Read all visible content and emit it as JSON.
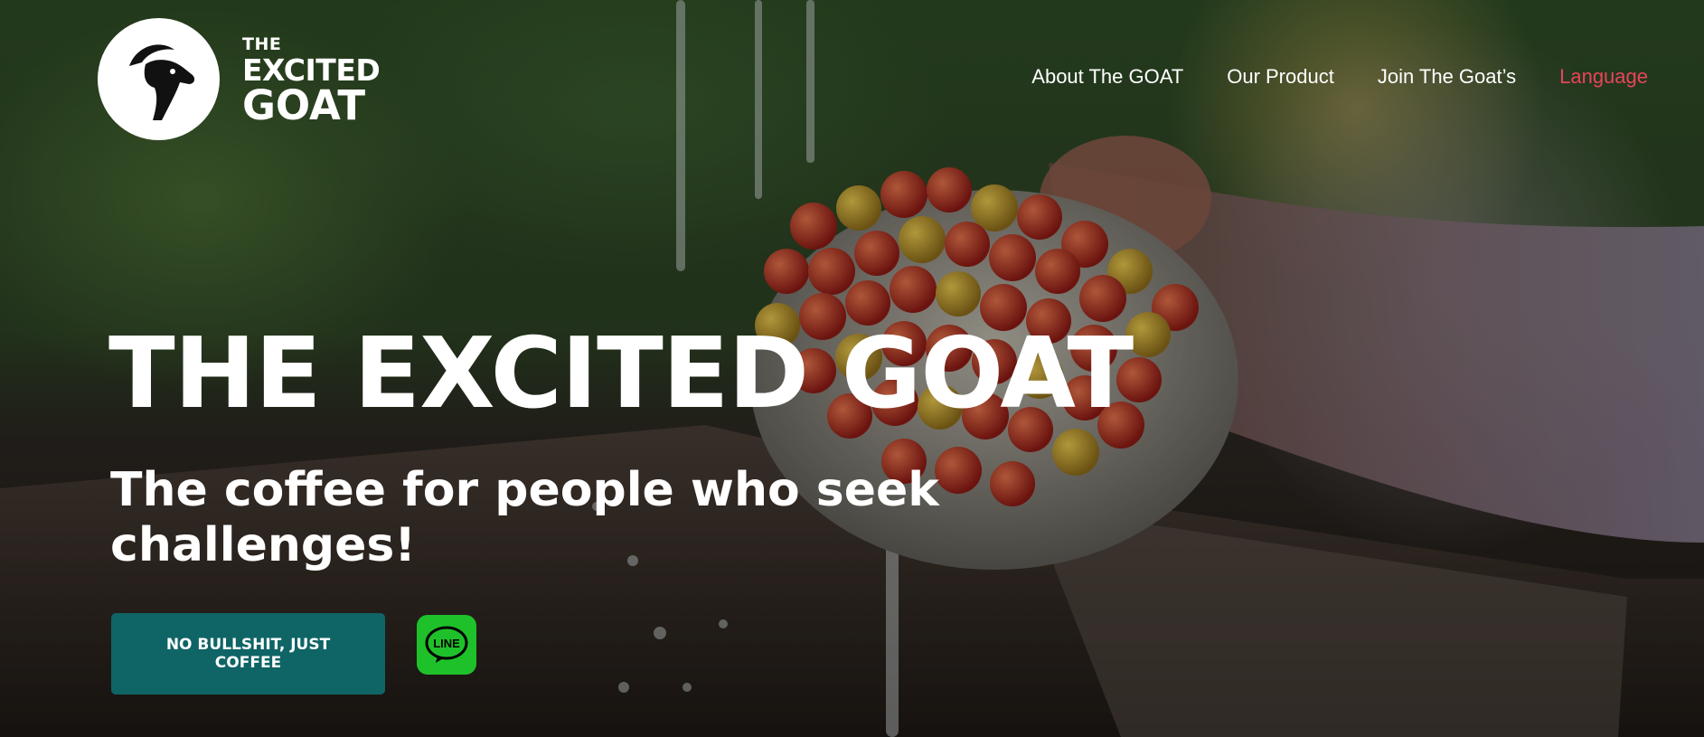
{
  "brand": {
    "logo_line1": "THE",
    "logo_line2": "EXCITED",
    "logo_line3": "GOAT",
    "logo_icon": "goat-head-icon"
  },
  "nav": {
    "items": [
      {
        "label": "About The GOAT"
      },
      {
        "label": "Our Product"
      },
      {
        "label": "Join The Goat’s"
      },
      {
        "label": "Language"
      }
    ],
    "accent_color": "#e8455a"
  },
  "hero": {
    "title": "THE EXCITED GOAT",
    "subtitle": "The coffee for people who seek challenges!",
    "cta_label": "NO BULLSHIT, JUST COFFEE",
    "cta_color": "#0f6466",
    "line_label": "LINE",
    "line_icon": "line-app-icon",
    "line_color": "#1fc12b"
  }
}
